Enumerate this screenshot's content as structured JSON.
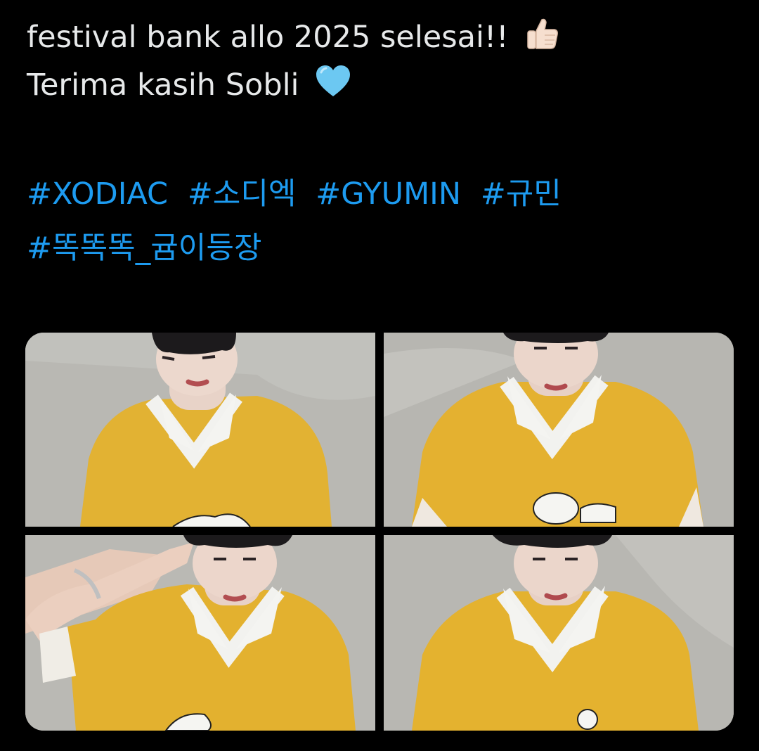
{
  "tweet": {
    "line1": "festival bank allo 2025 selesai!!",
    "line1_emoji": "thumbs-up-icon",
    "line2": "Terima kasih Sobli",
    "line2_emoji": "light-blue-heart-icon",
    "hashtags_row1": [
      "#XODIAC",
      "#소디엑",
      "#GYUMIN",
      "#규민"
    ],
    "hashtags_row2": [
      "#똑똑똑_귬이등장"
    ]
  },
  "media": {
    "count": 4,
    "photos": [
      {
        "name": "photo-1"
      },
      {
        "name": "photo-2"
      },
      {
        "name": "photo-3"
      },
      {
        "name": "photo-4"
      }
    ]
  },
  "colors": {
    "background": "#000000",
    "text": "#e7e9ea",
    "hashtag": "#1d9bf0",
    "shirt": "#e9b52d"
  }
}
